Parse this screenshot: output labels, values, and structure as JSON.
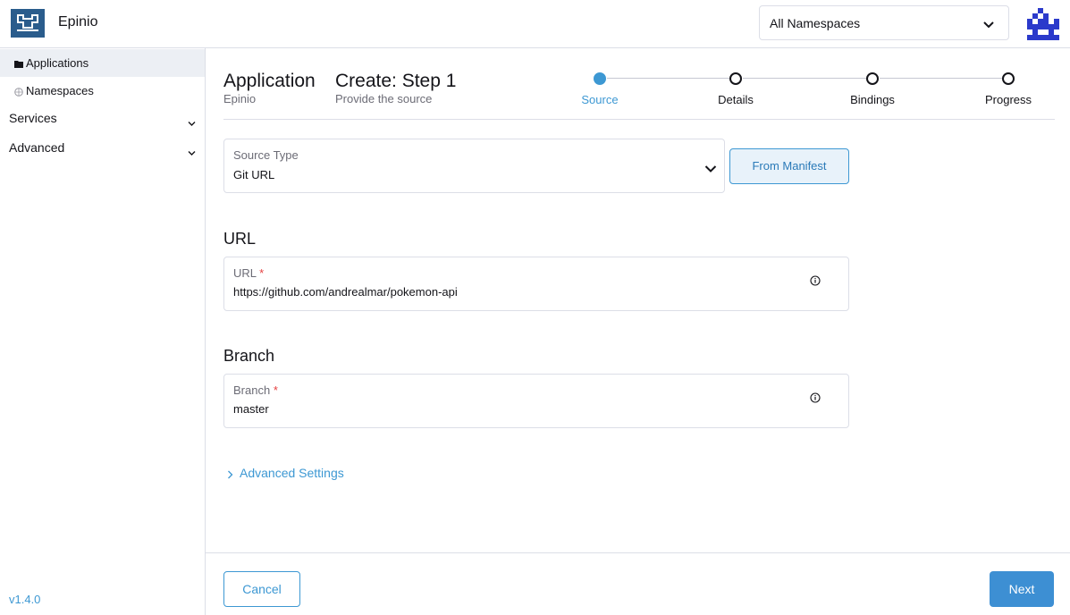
{
  "header": {
    "app_name": "Epinio",
    "namespace_select": "All Namespaces",
    "logo_icon": "epinio-logo-icon",
    "avatar_icon": "user-avatar-icon",
    "brand_color": "#2a5c8c"
  },
  "sidebar": {
    "items": [
      {
        "label": "Applications",
        "icon": "folder-icon",
        "active": true
      },
      {
        "label": "Namespaces",
        "icon": "globe-icon",
        "active": false
      }
    ],
    "groups": [
      {
        "label": "Services"
      },
      {
        "label": "Advanced"
      }
    ],
    "version": "v1.4.0"
  },
  "page": {
    "title": "Application",
    "subtitle": "Epinio",
    "step_title": "Create: Step 1",
    "step_subtitle": "Provide the source"
  },
  "stepper": {
    "steps": [
      {
        "label": "Source",
        "active": true
      },
      {
        "label": "Details",
        "active": false
      },
      {
        "label": "Bindings",
        "active": false
      },
      {
        "label": "Progress",
        "active": false
      }
    ]
  },
  "form": {
    "source_type_label": "Source Type",
    "source_type_value": "Git URL",
    "from_manifest_button": "From Manifest",
    "url_section": "URL",
    "url_label": "URL",
    "url_value": "https://github.com/andrealmar/pokemon-api",
    "branch_section": "Branch",
    "branch_label": "Branch",
    "branch_value": "master",
    "required_mark": "*",
    "advanced_settings": "Advanced Settings"
  },
  "footer": {
    "cancel": "Cancel",
    "next": "Next"
  },
  "colors": {
    "accent": "#3d98d3",
    "required": "#e53f3f",
    "border": "#dcdee7"
  }
}
